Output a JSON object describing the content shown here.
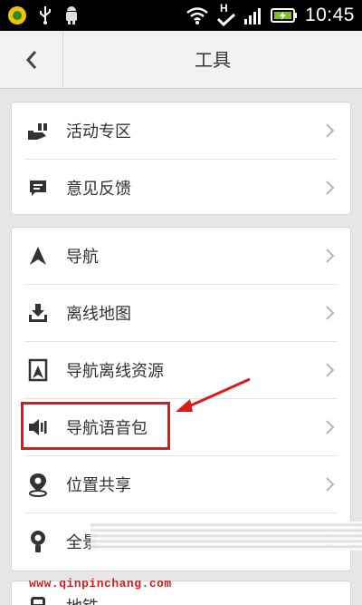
{
  "status_bar": {
    "time": "10:45",
    "icons": [
      "app-icon",
      "usb-icon",
      "android-icon",
      "wifi-icon",
      "check-icon",
      "signal-icon",
      "battery-icon"
    ],
    "signal_letter": "H"
  },
  "header": {
    "title": "工具",
    "back_icon": "chevron-left-icon"
  },
  "section1": {
    "items": [
      {
        "label": "活动专区",
        "icon": "gift-hand-icon"
      },
      {
        "label": "意见反馈",
        "icon": "message-icon"
      }
    ]
  },
  "section2": {
    "items": [
      {
        "label": "导航",
        "icon": "navigation-arrow-icon"
      },
      {
        "label": "离线地图",
        "icon": "download-tray-icon"
      },
      {
        "label": "导航离线资源",
        "icon": "navigation-frame-icon"
      },
      {
        "label": "导航语音包",
        "icon": "speaker-icon"
      },
      {
        "label": "位置共享",
        "icon": "location-pin-icon"
      },
      {
        "label": "全景",
        "icon": "panorama-pin-icon"
      }
    ]
  },
  "section3": {
    "items": [
      {
        "label": "地铁",
        "icon": "subway-icon"
      }
    ]
  },
  "annotation": {
    "highlight_color": "#e01818"
  },
  "watermark": "www.qinpinchang.com"
}
